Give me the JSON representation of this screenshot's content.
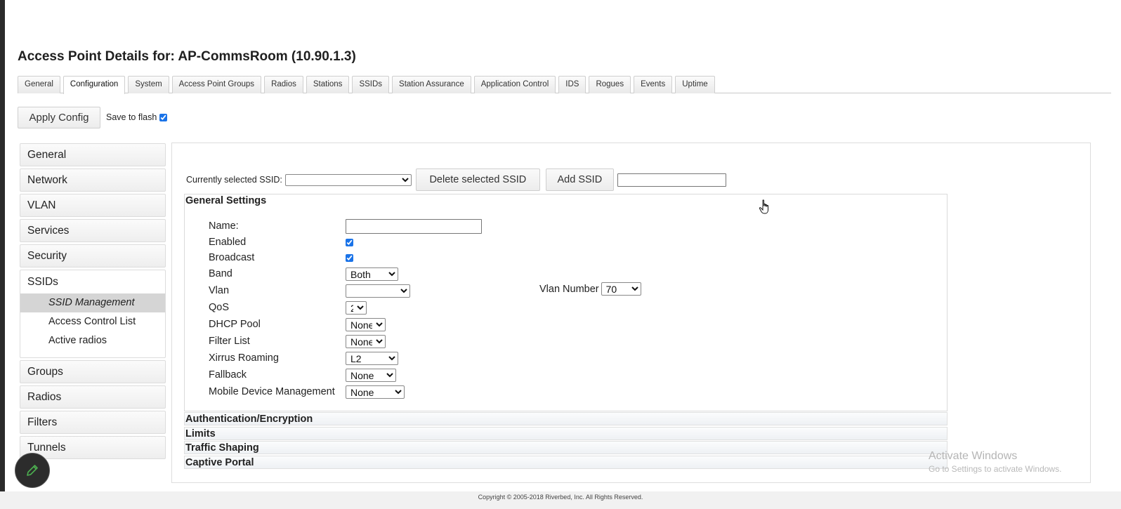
{
  "page": {
    "title": "Access Point Details for: AP-CommsRoom (10.90.1.3)"
  },
  "tabs": [
    {
      "label": "General"
    },
    {
      "label": "Configuration"
    },
    {
      "label": "System"
    },
    {
      "label": "Access Point Groups"
    },
    {
      "label": "Radios"
    },
    {
      "label": "Stations"
    },
    {
      "label": "SSIDs"
    },
    {
      "label": "Station Assurance"
    },
    {
      "label": "Application Control"
    },
    {
      "label": "IDS"
    },
    {
      "label": "Rogues"
    },
    {
      "label": "Events"
    },
    {
      "label": "Uptime"
    }
  ],
  "active_tab": "Configuration",
  "toolbar": {
    "apply_label": "Apply Config",
    "save_to_flash_label": "Save to flash",
    "save_to_flash_checked": true
  },
  "sidebar": {
    "items": [
      {
        "label": "General"
      },
      {
        "label": "Network"
      },
      {
        "label": "VLAN"
      },
      {
        "label": "Services"
      },
      {
        "label": "Security"
      },
      {
        "label": "SSIDs"
      },
      {
        "label": "Groups"
      },
      {
        "label": "Radios"
      },
      {
        "label": "Filters"
      },
      {
        "label": "Tunnels"
      }
    ],
    "ssids_subitems": [
      {
        "label": "SSID Management"
      },
      {
        "label": "Access Control List"
      },
      {
        "label": "Active radios"
      }
    ],
    "active_subitem": "SSID Management"
  },
  "ssid_bar": {
    "label": "Currently selected SSID:",
    "selected": "",
    "delete_label": "Delete selected SSID",
    "add_label": "Add SSID",
    "add_value": ""
  },
  "general_settings": {
    "title": "General Settings",
    "name_label": "Name:",
    "name_value": "",
    "enabled_label": "Enabled",
    "enabled": true,
    "broadcast_label": "Broadcast",
    "broadcast": true,
    "band_label": "Band",
    "band_value": "Both",
    "vlan_label": "Vlan",
    "vlan_value": "",
    "vlan_number_label": "Vlan Number",
    "vlan_number_value": "70",
    "qos_label": "QoS",
    "qos_value": "2",
    "dhcp_label": "DHCP Pool",
    "dhcp_value": "None",
    "filter_label": "Filter List",
    "filter_value": "None",
    "roaming_label": "Xirrus Roaming",
    "roaming_value": "L2",
    "fallback_label": "Fallback",
    "fallback_value": "None",
    "mdm_label": "Mobile Device Management",
    "mdm_value": "None"
  },
  "sections": [
    {
      "label": "Authentication/Encryption"
    },
    {
      "label": "Limits"
    },
    {
      "label": "Traffic Shaping"
    },
    {
      "label": "Captive Portal"
    }
  ],
  "watermark": {
    "line1": "Activate Windows",
    "line2": "Go to Settings to activate Windows."
  },
  "footer": {
    "text": "Copyright © 2005-2018 Riverbed, Inc. All Rights Reserved."
  },
  "icons": {
    "fab": "pencil-icon",
    "cursor": "hand-cursor-icon"
  },
  "colors": {
    "checkbox_accent": "#1a73e8",
    "active_subitem_bg": "#d5d5d5"
  }
}
